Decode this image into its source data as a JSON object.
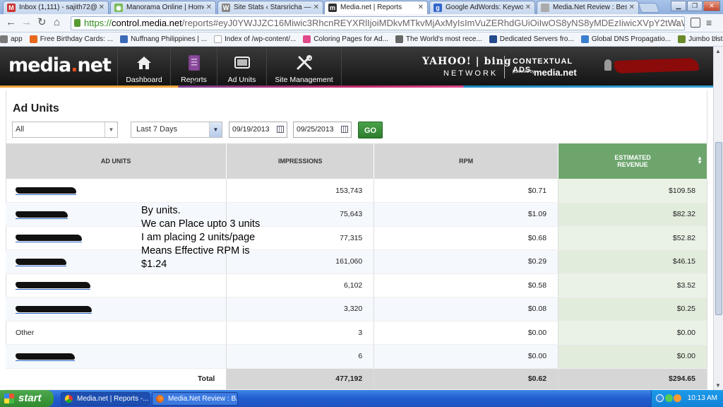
{
  "browser": {
    "tabs": [
      {
        "title": "Inbox (1,111) - sajith72@g",
        "favicon": "gmail-icon",
        "color": "#c33"
      },
      {
        "title": "Manorama Online | Home",
        "favicon": "manorama-icon",
        "color": "#7b5"
      },
      {
        "title": "Site Stats ‹ Starsricha — W",
        "favicon": "wordpress-icon",
        "color": "#888"
      },
      {
        "title": "Media.net | Reports",
        "favicon": "medianet-icon",
        "color": "#333"
      },
      {
        "title": "Google AdWords: Keyword I",
        "favicon": "google-icon",
        "color": "#36c"
      },
      {
        "title": "Media.Net Review : Best Ad",
        "favicon": "page-icon",
        "color": "#aaa"
      }
    ],
    "url": {
      "scheme": "https://",
      "host": "control.media.net",
      "path": "/reports#eyJ0YWJJZC16Miwic3RhcnREYXRlIjoiMDkvMTkvMjAxMyIsImVuZERhdGUiOiIwOS8yNS8yMDEzIiwicXVpY2tWaW"
    },
    "bookmarks": [
      {
        "label": "app",
        "color": "#7a7a7a"
      },
      {
        "label": "Free Birthday Cards: ...",
        "color": "#e8681e"
      },
      {
        "label": "Nuffnang Philippines | ...",
        "color": "#3b6bb6"
      },
      {
        "label": "Index of /wp-content/...",
        "color": "#ffffff"
      },
      {
        "label": "Coloring Pages for Ad...",
        "color": "#e04a8a"
      },
      {
        "label": "The World's most rece...",
        "color": "#666666"
      },
      {
        "label": "Dedicated Servers fro...",
        "color": "#234a8c"
      },
      {
        "label": "Global DNS Propagatio...",
        "color": "#3a7fcf"
      },
      {
        "label": "Jumbo List of High Pag...",
        "color": "#6a8a2a"
      }
    ],
    "bookmarks_more": "»"
  },
  "header": {
    "logo_main": "media",
    "logo_dot": ".",
    "logo_tail": "net",
    "nav": [
      {
        "label": "Dashboard",
        "icon": "home-icon"
      },
      {
        "label": "Reports",
        "icon": "reports-icon"
      },
      {
        "label": "Ad Units",
        "icon": "ad-units-icon"
      },
      {
        "label": "Site Management",
        "icon": "tools-icon"
      }
    ],
    "partner_yahoo_bing": "YAHOO! | bing",
    "partner_network": "NETWORK",
    "partner_contextual": "CONTEXTUAL ADS",
    "partner_powered": "powered by",
    "partner_powered_logo": "media.net"
  },
  "page": {
    "title": "Ad Units",
    "filter_value": "All",
    "period_value": "Last 7 Days",
    "start_date": "09/19/2013",
    "end_date": "09/25/2013",
    "go_label": "GO"
  },
  "table": {
    "headers": {
      "ad_units": "AD UNITS",
      "impressions": "IMPRESSIONS",
      "rpm": "RPM",
      "revenue_line1": "ESTIMATED",
      "revenue_line2": "REVENUE"
    },
    "rows": [
      {
        "name": "",
        "impressions": "153,743",
        "rpm": "$0.71",
        "revenue": "$109.58"
      },
      {
        "name": "",
        "impressions": "75,643",
        "rpm": "$1.09",
        "revenue": "$82.32"
      },
      {
        "name": "",
        "impressions": "77,315",
        "rpm": "$0.68",
        "revenue": "$52.82"
      },
      {
        "name": "",
        "impressions": "161,060",
        "rpm": "$0.29",
        "revenue": "$46.15"
      },
      {
        "name": "",
        "impressions": "6,102",
        "rpm": "$0.58",
        "revenue": "$3.52"
      },
      {
        "name": "",
        "impressions": "3,320",
        "rpm": "$0.08",
        "revenue": "$0.25"
      },
      {
        "name": "Other",
        "impressions": "3",
        "rpm": "$0.00",
        "revenue": "$0.00"
      },
      {
        "name": "",
        "impressions": "6",
        "rpm": "$0.00",
        "revenue": "$0.00"
      }
    ],
    "total": {
      "label": "Total",
      "impressions": "477,192",
      "rpm": "$0.62",
      "revenue": "$294.65"
    }
  },
  "annotation": {
    "lines": [
      "By units.",
      "We can Place upto 3 units",
      "I am placing 2 units/page",
      "Means Effective RPM is",
      "$1.24"
    ]
  },
  "taskbar": {
    "start_label": "start",
    "tasks": [
      {
        "label": "Media.net | Reports -...",
        "icon": "chrome-icon"
      },
      {
        "label": "Media.Net Review : B...",
        "icon": "firefox-icon"
      }
    ],
    "clock": "10:13 AM"
  }
}
